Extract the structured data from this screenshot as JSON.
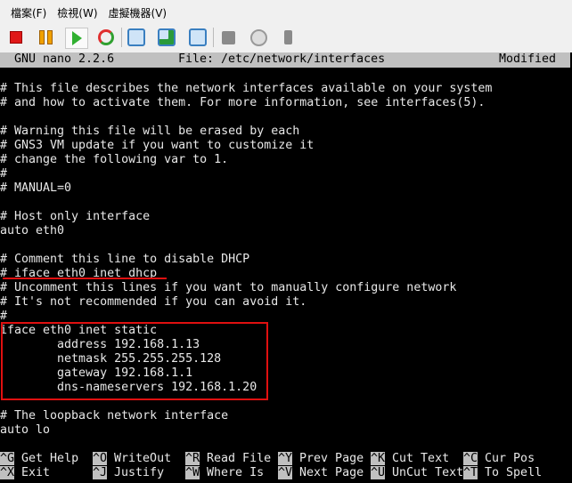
{
  "menu": [
    "檔案(F)",
    "檢視(W)",
    "虛擬機器(V)"
  ],
  "toolbar": [
    "stop-icon",
    "pause-icon",
    "play-icon",
    "reset-icon",
    "snapshot-icon",
    "restore-snapshot-icon",
    "snapshot-manager-icon",
    "floppy-icon",
    "cd-icon",
    "usb-icon"
  ],
  "nano": {
    "version": "GNU nano 2.2.6",
    "file": "File: /etc/network/interfaces",
    "status": "Modified",
    "lines": [
      "",
      "# This file describes the network interfaces available on your system",
      "# and how to activate them. For more information, see interfaces(5).",
      "",
      "# Warning this file will be erased by each",
      "# GNS3 VM update if you want to customize it",
      "# change the following var to 1.",
      "#",
      "# MANUAL=0",
      "",
      "# Host only interface",
      "auto eth0",
      "",
      "# Comment this line to disable DHCP",
      "# iface eth0 inet dhcp",
      "# Uncomment this lines if you want to manually configure network",
      "# It's not recommended if you can avoid it.",
      "#",
      "iface eth0 inet static",
      "        address 192.168.1.13",
      "        netmask 255.255.255.128",
      "        gateway 192.168.1.1",
      "        dns-nameservers 192.168.1.20",
      "",
      "# The loopback network interface",
      "auto lo"
    ],
    "shortcuts": [
      [
        {
          "key": "^G",
          "label": "Get Help"
        },
        {
          "key": "^O",
          "label": "WriteOut"
        },
        {
          "key": "^R",
          "label": "Read File"
        },
        {
          "key": "^Y",
          "label": "Prev Page"
        },
        {
          "key": "^K",
          "label": "Cut Text"
        },
        {
          "key": "^C",
          "label": "Cur Pos"
        }
      ],
      [
        {
          "key": "^X",
          "label": "Exit"
        },
        {
          "key": "^J",
          "label": "Justify"
        },
        {
          "key": "^W",
          "label": "Where Is"
        },
        {
          "key": "^V",
          "label": "Next Page"
        },
        {
          "key": "^U",
          "label": "UnCut Text"
        },
        {
          "key": "^T",
          "label": "To Spell"
        }
      ]
    ]
  },
  "highlight_color": "#e01010"
}
